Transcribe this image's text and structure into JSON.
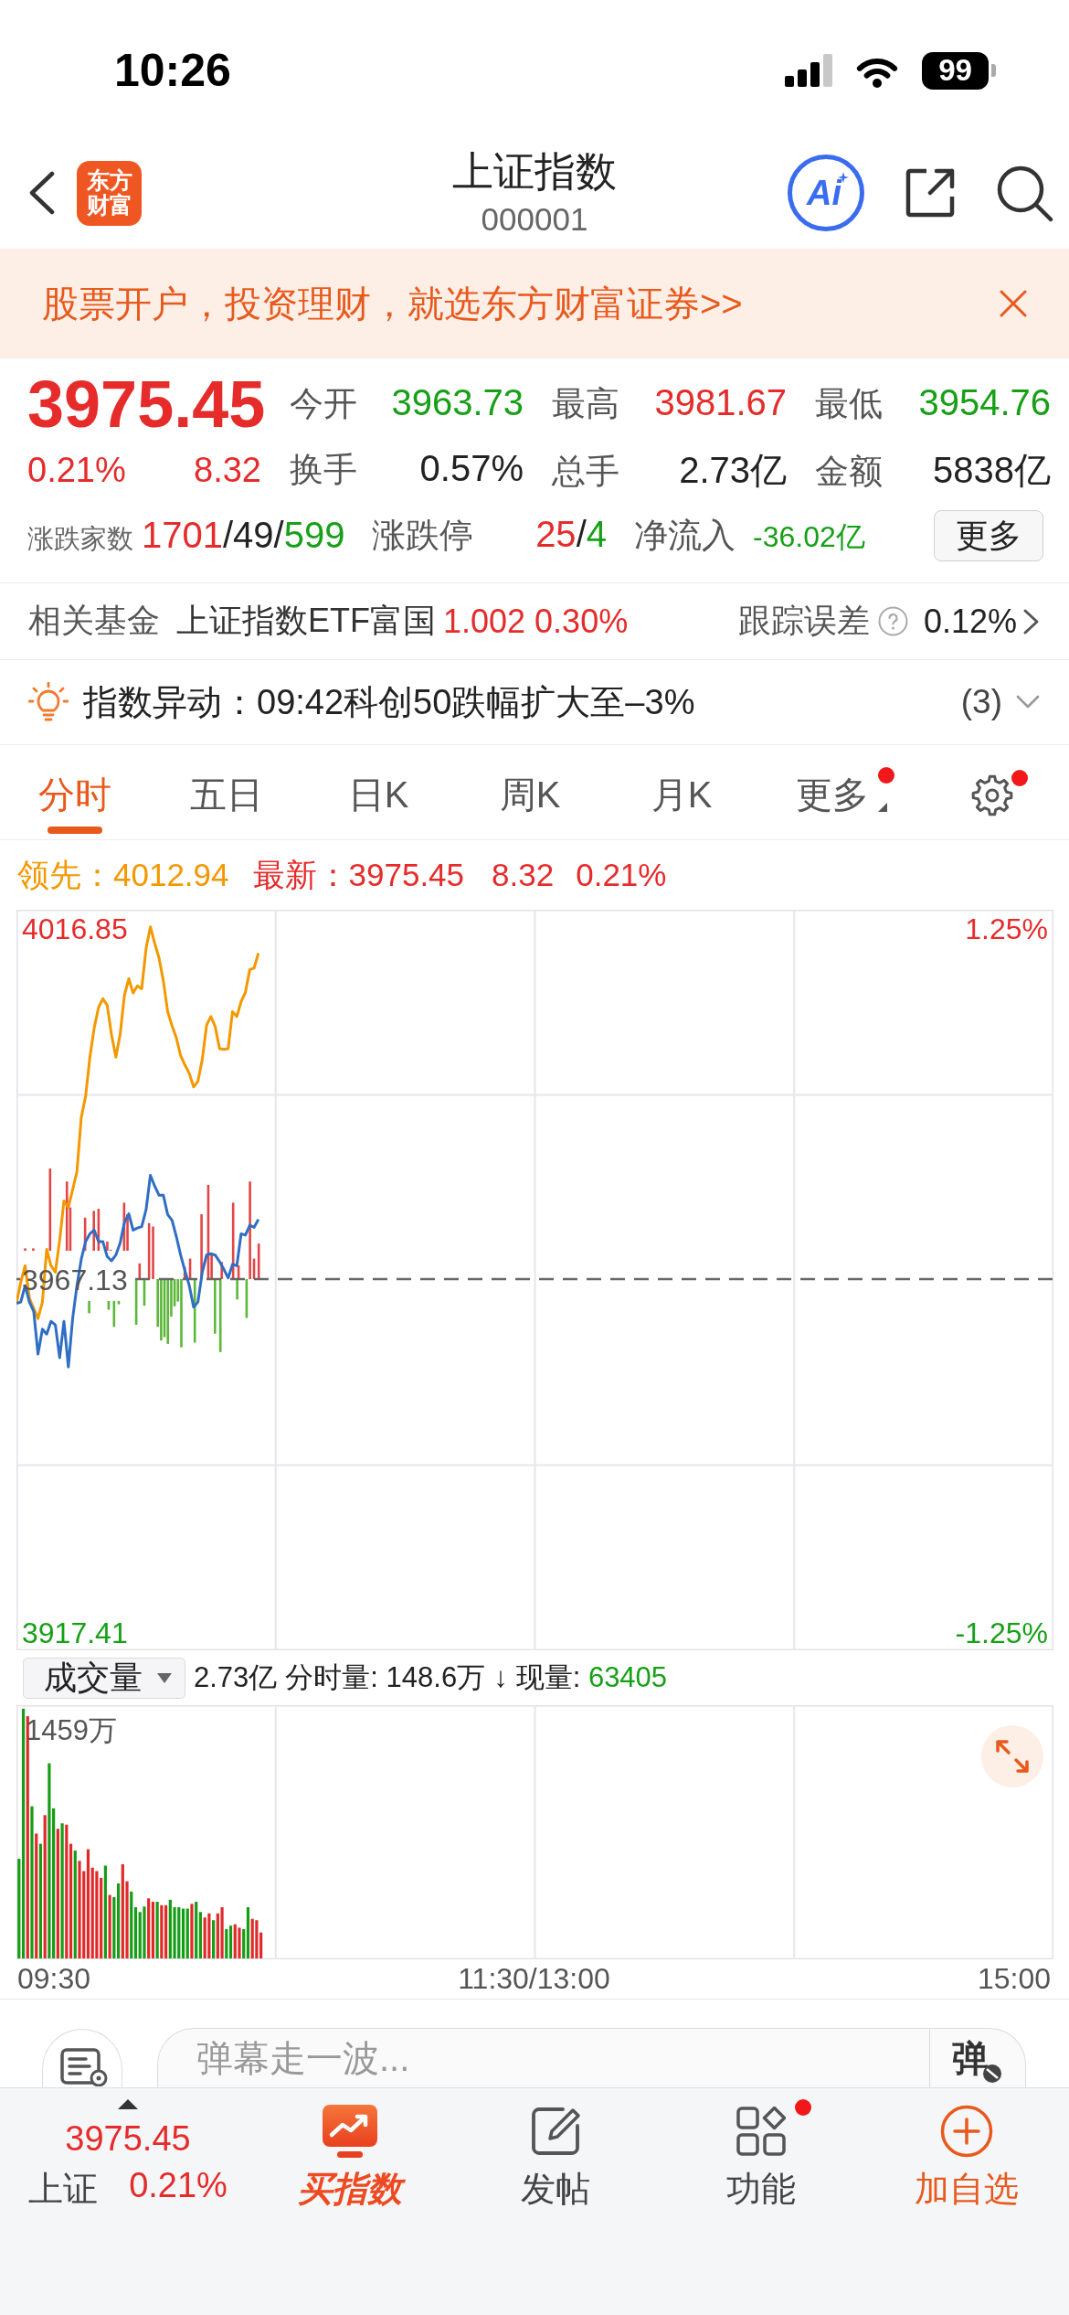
{
  "status_bar": {
    "time": "10:26",
    "battery": "99"
  },
  "header": {
    "logo_lines": [
      "东方",
      "财富"
    ],
    "title": "上证指数",
    "code": "000001",
    "ai_label": "Ai"
  },
  "banner": {
    "text": "股票开户，投资理财，就选东方财富证券>>"
  },
  "quote": {
    "price": {
      "text": "3975.45",
      "color": "#e62b2b"
    },
    "change_pct": {
      "text": "0.21%",
      "color": "#e62b2b"
    },
    "change": {
      "text": "8.32",
      "color": "#e62b2b"
    },
    "stats": [
      {
        "label": "今开",
        "value": "3963.73",
        "color": "#17a017"
      },
      {
        "label": "最高",
        "value": "3981.67",
        "color": "#e62b2b"
      },
      {
        "label": "最低",
        "value": "3954.76",
        "color": "#17a017"
      },
      {
        "label": "换手",
        "value": "0.57%",
        "color": "#222222"
      },
      {
        "label": "总手",
        "value": "2.73亿",
        "color": "#222222"
      },
      {
        "label": "金额",
        "value": "5838亿",
        "color": "#222222"
      }
    ],
    "breadth": [
      {
        "kind": "count",
        "label": "涨跌家数",
        "parts": [
          {
            "text": "1701",
            "color": "#e62b2b"
          },
          {
            "text": "/49/",
            "color": "#222222"
          },
          {
            "text": "599",
            "color": "#17a017"
          }
        ]
      },
      {
        "kind": "limit",
        "label": "涨跌停",
        "parts": [
          {
            "text": "25",
            "color": "#e62b2b"
          },
          {
            "text": "/",
            "color": "#222222"
          },
          {
            "text": "4",
            "color": "#17a017"
          }
        ]
      },
      {
        "kind": "flow",
        "label": "净流入",
        "parts": [
          {
            "text": "-36.02亿",
            "color": "#17a017"
          }
        ]
      }
    ],
    "more_button": "更多"
  },
  "fund": {
    "label": "相关基金",
    "name": "上证指数ETF富国",
    "price": {
      "text": "1.002",
      "color": "#e62b2b"
    },
    "change": {
      "text": "0.30%",
      "color": "#e62b2b"
    },
    "tracking_label": "跟踪误差",
    "tracking_value": "0.12%"
  },
  "alert": {
    "text": "指数异动：09:42科创50跌幅扩大至–3%",
    "count": "(3)",
    "expanded": false
  },
  "tab_bar": {
    "tabs": [
      {
        "label": "分时",
        "kind": "period",
        "selected": true,
        "badge": false
      },
      {
        "label": "五日",
        "kind": "period",
        "selected": false,
        "badge": false
      },
      {
        "label": "日K",
        "kind": "period",
        "selected": false,
        "badge": false
      },
      {
        "label": "周K",
        "kind": "period",
        "selected": false,
        "badge": false
      },
      {
        "label": "月K",
        "kind": "period",
        "selected": false,
        "badge": false
      },
      {
        "label": "更多",
        "kind": "menu",
        "selected": false,
        "badge": true
      }
    ],
    "settings": {
      "badge": true
    }
  },
  "chart": {
    "legend": [
      {
        "values": [
          "4012.94"
        ],
        "color": "#f39800"
      },
      {
        "values": [
          "3975.45",
          "8.32",
          "0.21%"
        ],
        "color": "#e62b2b"
      }
    ],
    "chart_data": {
      "type": "line",
      "categories": [
        null,
        null,
        null,
        null,
        null,
        null,
        null,
        null,
        null,
        null,
        null,
        null,
        null,
        null,
        null,
        null,
        null,
        null,
        null,
        null,
        null,
        null,
        null,
        null,
        null,
        null,
        null,
        null,
        null,
        null,
        null,
        null,
        null,
        null,
        null,
        null,
        null,
        null,
        null,
        null,
        null,
        null,
        null,
        null,
        null,
        null,
        null,
        null,
        null,
        null,
        null,
        null,
        null,
        null,
        null,
        null,
        null,
        null,
        null,
        null,
        null,
        null,
        null,
        null,
        null,
        null,
        null,
        null,
        null,
        null,
        null,
        null,
        null,
        null,
        null,
        null,
        null,
        null,
        null,
        null,
        null,
        null,
        null,
        null,
        null,
        null,
        null,
        null,
        null,
        null,
        null,
        null,
        null,
        null,
        null,
        null,
        null,
        null,
        null,
        null,
        null,
        null,
        null,
        null,
        null,
        null,
        null,
        null,
        null,
        null,
        null,
        null,
        null,
        null,
        null,
        null,
        null,
        null,
        null,
        null,
        null,
        null,
        null,
        null,
        null,
        null,
        null,
        null,
        null,
        null,
        null,
        null,
        null,
        null,
        null,
        null,
        null,
        null,
        null,
        null,
        null,
        null,
        null,
        null,
        null,
        null,
        null,
        null,
        null,
        null,
        null,
        null,
        null,
        null,
        null,
        null,
        null,
        null,
        null,
        null,
        null,
        null,
        null,
        null,
        null,
        null,
        null,
        null,
        null,
        null,
        null,
        null,
        null,
        null,
        null,
        null,
        null,
        null,
        null,
        null,
        null,
        null,
        null,
        null,
        null,
        null,
        null,
        null,
        null,
        null,
        null,
        null,
        null,
        null,
        null,
        null,
        null,
        null,
        null,
        null,
        null,
        null,
        null,
        null,
        null,
        null,
        null,
        null,
        null,
        null,
        null,
        null,
        null,
        null,
        null,
        null,
        null,
        null,
        null,
        null,
        null,
        null,
        null,
        null,
        null,
        null,
        null,
        null,
        null,
        null,
        null,
        null,
        null,
        null,
        null,
        null,
        null,
        null,
        null,
        null,
        null
      ],
      "series": [
        {
          "name": "领先：",
          "color": "#f39800",
          "values": [
            3963.7,
            3966.7,
            3969.0,
            3964.4,
            3963.0,
            3961.6,
            3963.9,
            3971.3,
            3969.0,
            3968.1,
            3972.6,
            3978.1,
            3977.2,
            3979.7,
            3982.2,
            3989.8,
            3992.8,
            3998.3,
            4002.4,
            4005.3,
            4006.5,
            4005.6,
            4001.5,
            3998.3,
            4001.5,
            4007.0,
            4009.3,
            4007.3,
            4008.3,
            4007.9,
            4013.6,
            4016.6,
            4014.3,
            4012.2,
            4009.0,
            4004.7,
            4002.7,
            4001.0,
            3998.5,
            3997.2,
            3996.0,
            3994.1,
            3994.9,
            3998.0,
            4002.8,
            4004.0,
            4002.6,
            3999.5,
            3999.4,
            3999.5,
            4004.7,
            4004.0,
            4006.1,
            4007.4,
            4010.6,
            4010.8,
            4012.9,
            null,
            null,
            null,
            null,
            null,
            null,
            null,
            null,
            null,
            null,
            null,
            null,
            null,
            null,
            null,
            null,
            null,
            null,
            null,
            null,
            null,
            null,
            null,
            null,
            null,
            null,
            null,
            null,
            null,
            null,
            null,
            null,
            null,
            null,
            null,
            null,
            null,
            null,
            null,
            null,
            null,
            null,
            null,
            null,
            null,
            null,
            null,
            null,
            null,
            null,
            null,
            null,
            null,
            null,
            null,
            null,
            null,
            null,
            null,
            null,
            null,
            null,
            null,
            null,
            null,
            null,
            null,
            null,
            null,
            null,
            null,
            null,
            null,
            null,
            null,
            null,
            null,
            null,
            null,
            null,
            null,
            null,
            null,
            null,
            null,
            null,
            null,
            null,
            null,
            null,
            null,
            null,
            null,
            null,
            null,
            null,
            null,
            null,
            null,
            null,
            null,
            null,
            null,
            null,
            null,
            null,
            null,
            null,
            null,
            null,
            null,
            null,
            null,
            null,
            null,
            null,
            null,
            null,
            null,
            null,
            null,
            null,
            null,
            null,
            null,
            null,
            null,
            null,
            null,
            null,
            null,
            null,
            null,
            null,
            null,
            null,
            null,
            null,
            null,
            null,
            null,
            null,
            null,
            null,
            null,
            null,
            null,
            null,
            null,
            null,
            null,
            null,
            null,
            null,
            null,
            null,
            null,
            null,
            null,
            null,
            null,
            null,
            null,
            null,
            null,
            null,
            null,
            null,
            null,
            null,
            null,
            null,
            null,
            null,
            null,
            null,
            null,
            null,
            null,
            null,
            null,
            null,
            null,
            null
          ]
        },
        {
          "name": "最新：",
          "color": "#2f6ec4",
          "values": [
            3963.7,
            3963.9,
            3966.2,
            3963.9,
            3962.6,
            3956.6,
            3960.1,
            3959.4,
            3961.2,
            3960.7,
            3956.1,
            3961.2,
            3954.8,
            3961.6,
            3966.2,
            3969.9,
            3972.4,
            3973.5,
            3974.0,
            3972.4,
            3972.4,
            3970.3,
            3969.7,
            3970.5,
            3972.2,
            3975.1,
            3976.3,
            3974.0,
            3974.3,
            3974.5,
            3976.9,
            3981.7,
            3980.2,
            3978.9,
            3978.9,
            3976.2,
            3975.4,
            3973.1,
            3970.5,
            3968.3,
            3966.2,
            3963.2,
            3963.9,
            3968.1,
            3970.5,
            3970.7,
            3970.5,
            3969.6,
            3968.5,
            3967.3,
            3969.2,
            3969.0,
            3973.5,
            3973.3,
            3974.7,
            3974.4,
            3975.5,
            null,
            null,
            null,
            null,
            null,
            null,
            null,
            null,
            null,
            null,
            null,
            null,
            null,
            null,
            null,
            null,
            null,
            null,
            null,
            null,
            null,
            null,
            null,
            null,
            null,
            null,
            null,
            null,
            null,
            null,
            null,
            null,
            null,
            null,
            null,
            null,
            null,
            null,
            null,
            null,
            null,
            null,
            null,
            null,
            null,
            null,
            null,
            null,
            null,
            null,
            null,
            null,
            null,
            null,
            null,
            null,
            null,
            null,
            null,
            null,
            null,
            null,
            null,
            null,
            null,
            null,
            null,
            null,
            null,
            null,
            null,
            null,
            null,
            null,
            null,
            null,
            null,
            null,
            null,
            null,
            null,
            null,
            null,
            null,
            null,
            null,
            null,
            null,
            null,
            null,
            null,
            null,
            null,
            null,
            null,
            null,
            null,
            null,
            null,
            null,
            null,
            null,
            null,
            null,
            null,
            null,
            null,
            null,
            null,
            null,
            null,
            null,
            null,
            null,
            null,
            null,
            null,
            null,
            null,
            null,
            null,
            null,
            null,
            null,
            null,
            null,
            null,
            null,
            null,
            null,
            null,
            null,
            null,
            null,
            null,
            null,
            null,
            null,
            null,
            null,
            null,
            null,
            null,
            null,
            null,
            null,
            null,
            null,
            null,
            null,
            null,
            null,
            null,
            null,
            null,
            null,
            null,
            null,
            null,
            null,
            null,
            null,
            null,
            null,
            null,
            null,
            null,
            null,
            null,
            null,
            null,
            null,
            null,
            null,
            null,
            null,
            null,
            null,
            null,
            null,
            null,
            null,
            null,
            null
          ]
        }
      ],
      "ylim": [
        3915.0,
        4019.0
      ],
      "yticks": [
        {
          "value": 3917.41,
          "label": "3917.41"
        },
        {
          "value": 3967.13,
          "label": "3967.13"
        },
        {
          "value": 4016.85,
          "label": "4016.85"
        }
      ],
      "ref_lines": [
        {
          "axis": "y",
          "value": 3967.13
        }
      ]
    },
    "right_labels": [
      {
        "text": "1.25%",
        "color": "#e62b2b"
      },
      {
        "text": "-1.25%",
        "color": "#17a017"
      }
    ]
  },
  "volume": {
    "selector": "成交量",
    "total": "2.73亿",
    "interval": {
      "label": "分时量:",
      "value": "148.6万"
    },
    "arrow": "↓",
    "current": {
      "label": "现量:",
      "value": "63405",
      "color": "#17a017"
    },
    "max_label": "1459万"
  },
  "time_axis": [
    "09:30",
    "11:30/13:00",
    "15:00"
  ],
  "comment": {
    "placeholder": "弹幕走一波...",
    "send_label": "弹"
  },
  "bottom_bar": {
    "ticker": {
      "price": "3975.45",
      "name": "上证",
      "change": "0.21%",
      "color": "#e62b2b",
      "rising": true
    },
    "items": [
      {
        "label": "买指数",
        "kind": "promo",
        "badge": false
      },
      {
        "label": "发帖",
        "kind": "post",
        "badge": false
      },
      {
        "label": "功能",
        "kind": "tools",
        "badge": true
      },
      {
        "label": "加自选",
        "kind": "add",
        "badge": false
      }
    ]
  }
}
